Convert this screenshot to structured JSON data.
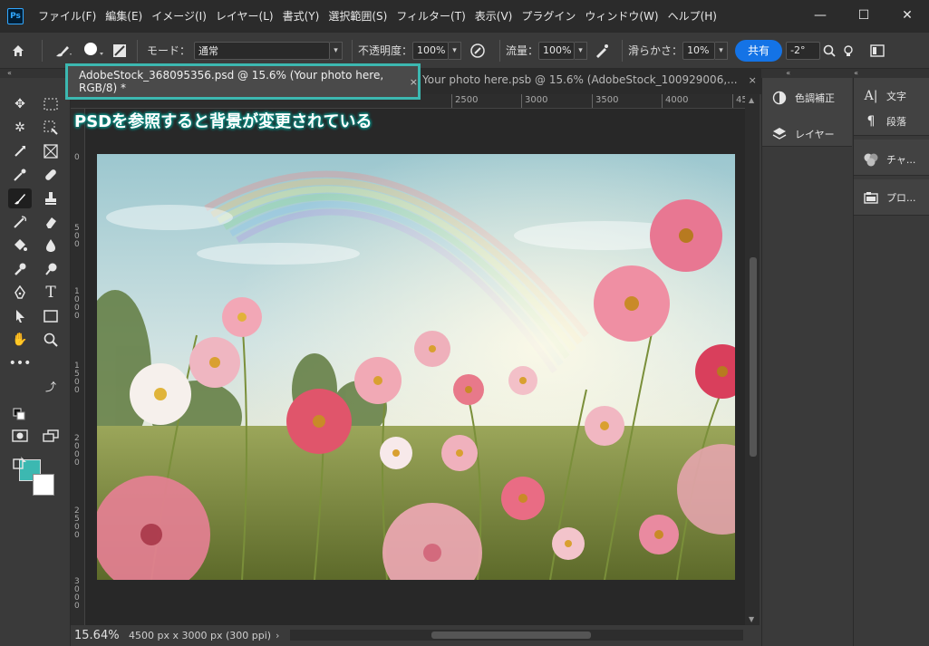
{
  "app": {
    "logo": "Ps",
    "menu": [
      "ファイル(F)",
      "編集(E)",
      "イメージ(I)",
      "レイヤー(L)",
      "書式(Y)",
      "選択範囲(S)",
      "フィルター(T)",
      "表示(V)",
      "プラグイン",
      "ウィンドウ(W)",
      "ヘルプ(H)"
    ],
    "window_controls": [
      "—",
      "☐",
      "✕"
    ]
  },
  "options": {
    "mode_label": "モード：",
    "mode_value": "通常",
    "opacity_label": "不透明度：",
    "opacity_value": "100%",
    "flow_label": "流量：",
    "flow_value": "100%",
    "smoothing_label": "滑らかさ：",
    "smoothing_value": "10%",
    "share_label": "共有",
    "angle_value": "-2°"
  },
  "tabs": {
    "active": "AdobeStock_368095356.psd @ 15.6% (Your photo here, RGB/8) *",
    "second": "Your photo here.psb @ 15.6% (AdobeStock_100929006,...",
    "close": "×"
  },
  "ruler": {
    "top": [
      "2500",
      "3000",
      "3500",
      "4000",
      "45"
    ],
    "left": [
      "0",
      "500",
      "1000",
      "1500",
      "2000",
      "2500",
      "3000"
    ]
  },
  "annotation": "PSDを参照すると背景が変更されている",
  "status": {
    "zoom": "15.64%",
    "doc_info": "4500 px x 3000 px (300 ppi)",
    "arrow": "›"
  },
  "panels": {
    "col1": [
      {
        "icon": "adjustments-icon",
        "label": "色調補正"
      },
      {
        "icon": "layers-icon",
        "label": "レイヤー"
      }
    ],
    "col2": [
      {
        "icon": "character-icon",
        "label": "文字"
      },
      {
        "icon": "paragraph-icon",
        "label": "段落"
      },
      {
        "icon": "channels-icon",
        "label": "チャ..."
      },
      {
        "icon": "properties-icon",
        "label": "プロ..."
      }
    ]
  },
  "colors": {
    "foreground": "#3cb8b1",
    "background": "#ffffff",
    "accent": "#1473e6",
    "highlight": "#3cb8b1"
  }
}
